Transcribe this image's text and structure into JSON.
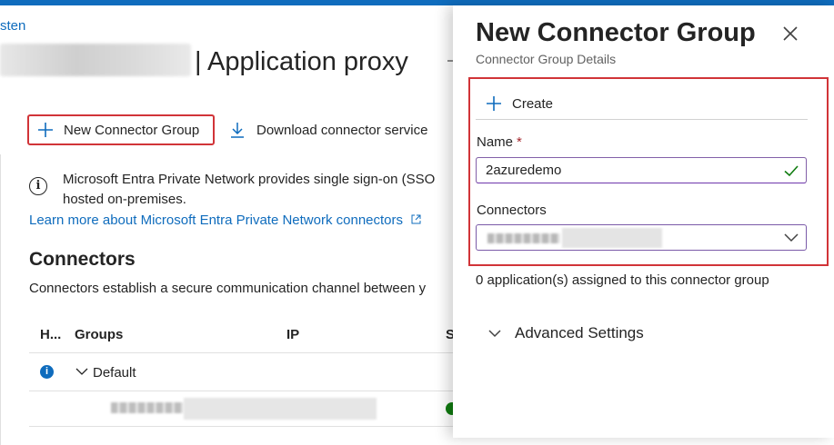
{
  "breadcrumb": {
    "link_text": "sten"
  },
  "page": {
    "title": "| Application proxy"
  },
  "commandbar": {
    "new_connector_group": "New Connector Group",
    "download_connector_service": "Download connector service"
  },
  "info": {
    "line1": "Microsoft Entra Private Network provides single sign-on (SSO",
    "line2": "hosted on-premises.",
    "learn_more": "Learn more about Microsoft Entra Private Network connectors"
  },
  "connectors_section": {
    "title": "Connectors",
    "description": "Connectors establish a secure communication channel between y",
    "columns": [
      "H...",
      "Groups",
      "IP",
      "S"
    ],
    "rows": [
      {
        "group": "Default"
      }
    ]
  },
  "panel": {
    "title": "New Connector Group",
    "subtitle": "Connector Group Details",
    "create_label": "Create",
    "name_label": "Name",
    "required_marker": "*",
    "name_value": "2azuredemo",
    "connectors_label": "Connectors",
    "assigned_text": "0 application(s) assigned to this connector group",
    "advanced_settings": "Advanced Settings"
  },
  "icons": {
    "add": "plus-icon",
    "download": "download-icon",
    "info": "info-icon",
    "external": "external-link-icon",
    "close": "close-icon",
    "valid": "checkmark-icon",
    "dropdown": "chevron-down-icon",
    "expand": "chevron-down-icon"
  },
  "colors": {
    "accent": "#0f6cbd",
    "highlight_border": "#d13438",
    "required": "#a4262c",
    "valid": "#107c10"
  }
}
